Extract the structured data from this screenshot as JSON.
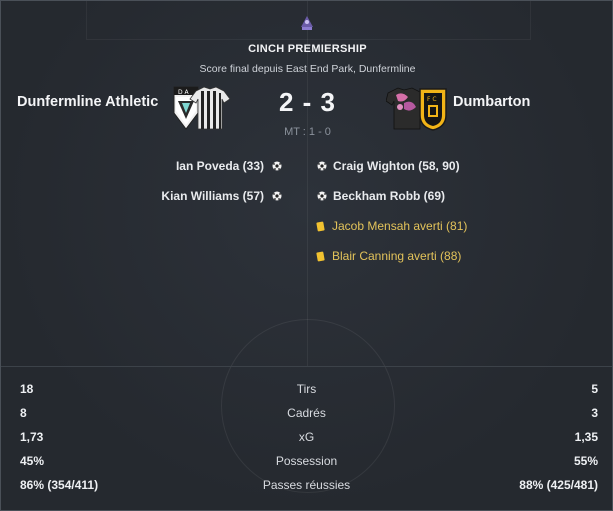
{
  "competition": {
    "name": "CINCH PREMIERSHIP",
    "subtitle": "Score final depuis East End Park, Dunfermline"
  },
  "home": {
    "name": "Dunfermline Athletic",
    "crest_icon": "dunfermline-crest-icon"
  },
  "away": {
    "name": "Dumbarton",
    "crest_icon": "dumbarton-crest-icon"
  },
  "score": "2 - 3",
  "half_time": "MT : 1 - 0",
  "events": {
    "home_goals": [
      "Ian Poveda (33)",
      "Kian Williams (57)"
    ],
    "away_goals": [
      "Craig Wighton (58, 90)",
      "Beckham Robb (69)"
    ],
    "away_cards": [
      "Jacob Mensah averti (81)",
      "Blair Canning averti (88)"
    ]
  },
  "stats": [
    {
      "label": "Tirs",
      "home": "18",
      "away": "5"
    },
    {
      "label": "Cadrés",
      "home": "8",
      "away": "3"
    },
    {
      "label": "xG",
      "home": "1,73",
      "away": "1,35"
    },
    {
      "label": "Possession",
      "home": "45%",
      "away": "55%"
    },
    {
      "label": "Passes réussies",
      "home": "86% (354/411)",
      "away": "88% (425/481)"
    }
  ],
  "colors": {
    "background": "#25292f",
    "yellow_card": "#f2c230",
    "card_text": "#e3c35a",
    "muted": "#8b929c"
  }
}
